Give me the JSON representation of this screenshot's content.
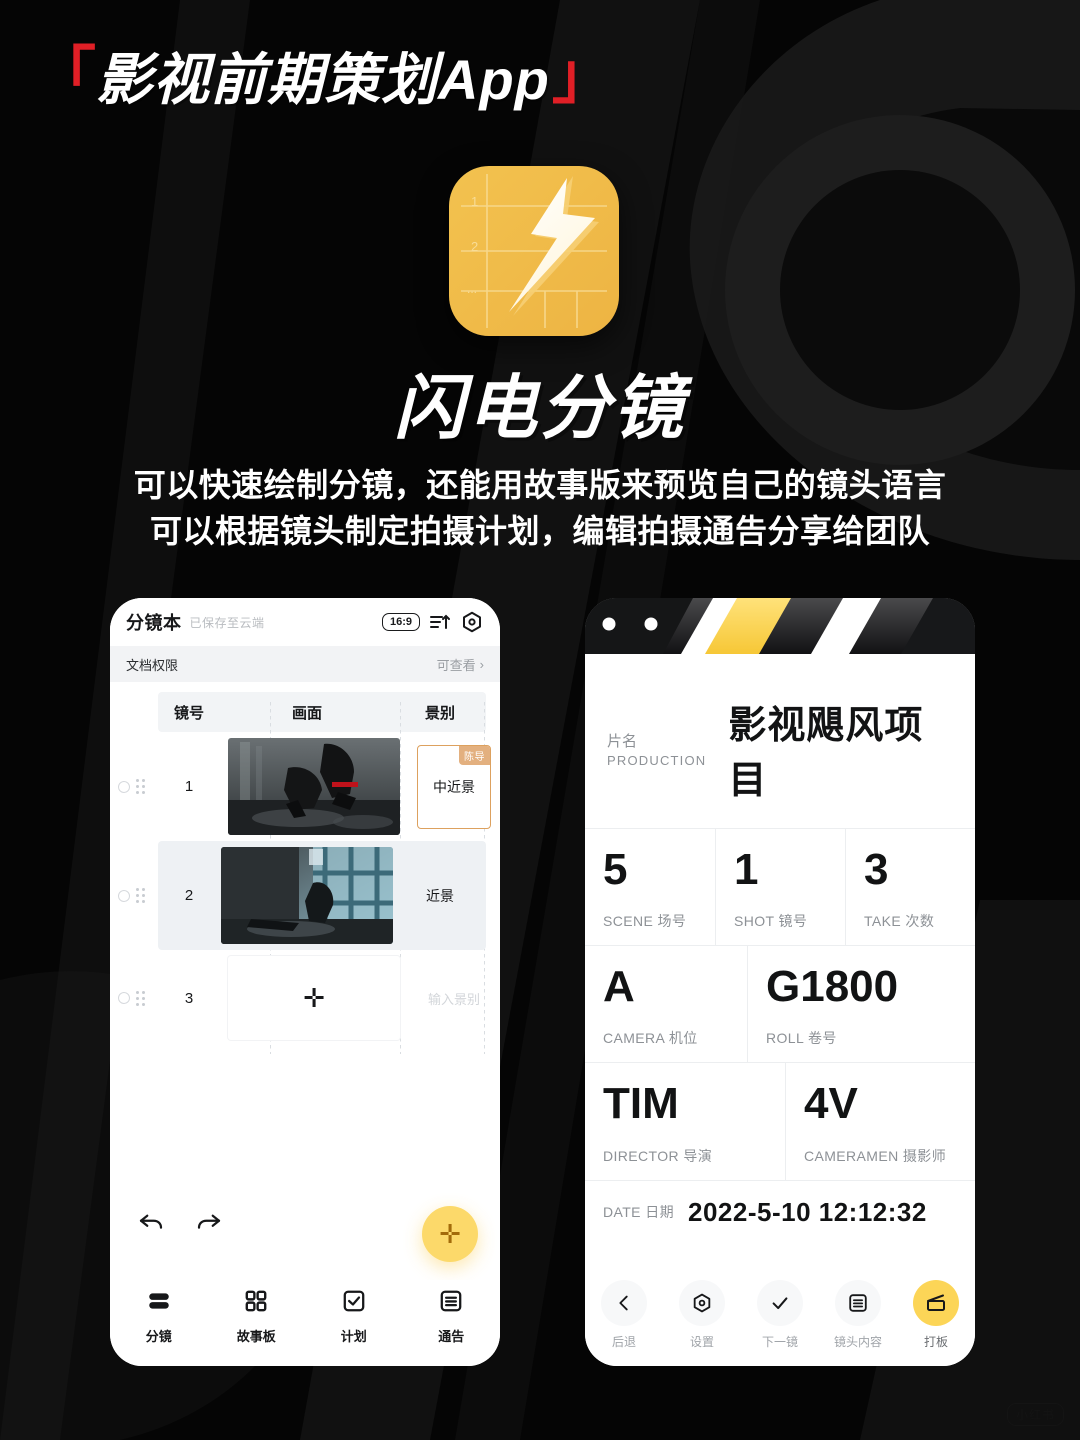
{
  "poster": {
    "headline": "影视前期策划App",
    "bracket_left": "「",
    "bracket_right": "」",
    "app_name": "闪电分镜",
    "desc_line1": "可以快速绘制分镜，还能用故事版来预览自己的镜头语言",
    "desc_line2": "可以根据镜头制定拍摄计划，编辑拍摄通告分享给团队",
    "watermark": "小红书",
    "accent_red": "#e01f26",
    "accent_yellow": "#fcd557",
    "bg": "#050505"
  },
  "left_phone": {
    "header": {
      "title": "分镜本",
      "subtitle": "已保存至云端",
      "ratio_badge": "16:9",
      "sort_icon": "sort-ascending-icon",
      "settings_icon": "gear-hex-icon"
    },
    "permission": {
      "label": "文档权限",
      "value": "可查看",
      "chevron": "›"
    },
    "table": {
      "columns": [
        "镜号",
        "画面",
        "景别"
      ],
      "rows": [
        {
          "no": "1",
          "shot_type": "中近景",
          "tag": "陈导",
          "selected": true,
          "has_image": true
        },
        {
          "no": "2",
          "shot_type": "近景",
          "tag": "",
          "selected": false,
          "has_image": true
        },
        {
          "no": "3",
          "shot_type": "",
          "placeholder": "输入景别",
          "tag": "",
          "selected": false,
          "has_image": false,
          "add_glyph": "✛"
        }
      ]
    },
    "tools": {
      "undo_icon": "undo-arrow-icon",
      "redo_icon": "redo-arrow-icon",
      "fab_glyph": "✛",
      "fab_name": "add-shot-fab"
    },
    "nav": [
      {
        "label": "分镜",
        "icon": "storyboard-rows-icon",
        "active": true
      },
      {
        "label": "故事板",
        "icon": "grid-four-icon",
        "active": false
      },
      {
        "label": "计划",
        "icon": "check-square-icon",
        "active": false
      },
      {
        "label": "通告",
        "icon": "list-square-icon",
        "active": false
      }
    ]
  },
  "right_phone": {
    "production": {
      "label_cn": "片名",
      "label_en": "PRODUCTION",
      "title": "影视飓风项目"
    },
    "fields_row1": [
      {
        "value": "5",
        "label": "SCENE 场号"
      },
      {
        "value": "1",
        "label": "SHOT 镜号"
      },
      {
        "value": "3",
        "label": "TAKE 次数"
      }
    ],
    "fields_row2": [
      {
        "value": "A",
        "label": "CAMERA 机位"
      },
      {
        "value": "G1800",
        "label": "ROLL 卷号"
      }
    ],
    "fields_row3": [
      {
        "value": "TIM",
        "label": "DIRECTOR 导演"
      },
      {
        "value": "4V",
        "label": "CAMERAMEN 摄影师"
      }
    ],
    "date": {
      "label": "DATE 日期",
      "value": "2022-5-10 12:12:32"
    },
    "toolbar": [
      {
        "label": "后退",
        "icon": "arrow-left-icon",
        "active": false
      },
      {
        "label": "设置",
        "icon": "gear-hex-icon",
        "active": false
      },
      {
        "label": "下一镜",
        "icon": "check-icon",
        "active": false
      },
      {
        "label": "镜头内容",
        "icon": "list-square-icon",
        "active": false
      },
      {
        "label": "打板",
        "icon": "clapper-icon",
        "active": true
      }
    ]
  }
}
